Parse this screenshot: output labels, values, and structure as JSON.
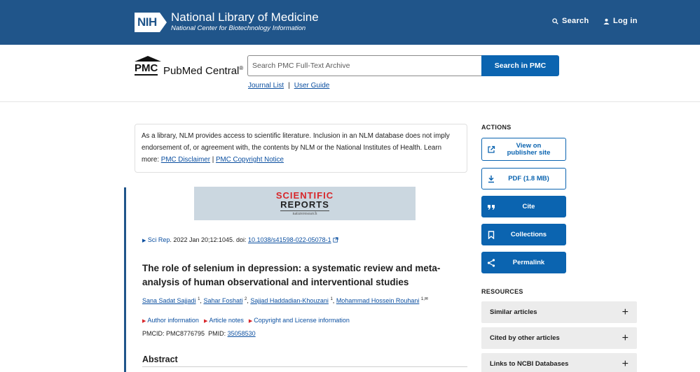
{
  "header": {
    "logo_text": "NIH",
    "org_name": "National Library of Medicine",
    "org_sub": "National Center for Biotechnology Information",
    "search_label": "Search",
    "login_label": "Log in"
  },
  "pmc": {
    "logo_abbr": "PMC",
    "logo_name": "PubMed Central",
    "logo_reg": "®",
    "search_placeholder": "Search PMC Full-Text Archive",
    "search_button": "Search in PMC",
    "journal_list": "Journal List",
    "separator": "|",
    "user_guide": "User Guide"
  },
  "disclaimer": {
    "text": "As a library, NLM provides access to scientific literature. Inclusion in an NLM database does not imply endorsement of, or agreement with, the contents by NLM or the National Institutes of Health.",
    "learn_more": "Learn more:",
    "link1": "PMC Disclaimer",
    "sep": "|",
    "link2": "PMC Copyright Notice"
  },
  "journal_banner": {
    "line1": "SCIENTIFIC",
    "line2": "REPORTS",
    "line3": "natureresearch"
  },
  "article": {
    "journal": "Sci Rep",
    "citation": ". 2022 Jan 20;12:1045. doi: ",
    "doi": "10.1038/s41598-022-05078-1",
    "title": "The role of selenium in depression: a systematic review and meta-analysis of human observational and interventional studies",
    "authors": [
      {
        "name": "Sana Sadat Sajjadi",
        "sup": "1"
      },
      {
        "name": "Sahar Foshati",
        "sup": "2"
      },
      {
        "name": "Sajjad Haddadian-Khouzani",
        "sup": "1"
      },
      {
        "name": "Mohammad Hossein Rouhani",
        "sup": "1,✉"
      }
    ],
    "meta_links": [
      "Author information",
      "Article notes",
      "Copyright and License information"
    ],
    "pmcid_label": "PMCID: PMC8776795",
    "pmid_label": "PMID:",
    "pmid": "35058530",
    "abstract_heading": "Abstract"
  },
  "actions": {
    "heading": "ACTIONS",
    "view_publisher": "View on publisher site",
    "pdf": "PDF (1.8 MB)",
    "cite": "Cite",
    "collections": "Collections",
    "permalink": "Permalink"
  },
  "resources": {
    "heading": "RESOURCES",
    "items": [
      "Similar articles",
      "Cited by other articles",
      "Links to NCBI Databases"
    ]
  },
  "colors": {
    "header_bg": "#20558a",
    "primary_button": "#0b64b0",
    "link": "#0b4fa0",
    "accent_red": "#d8262a"
  }
}
